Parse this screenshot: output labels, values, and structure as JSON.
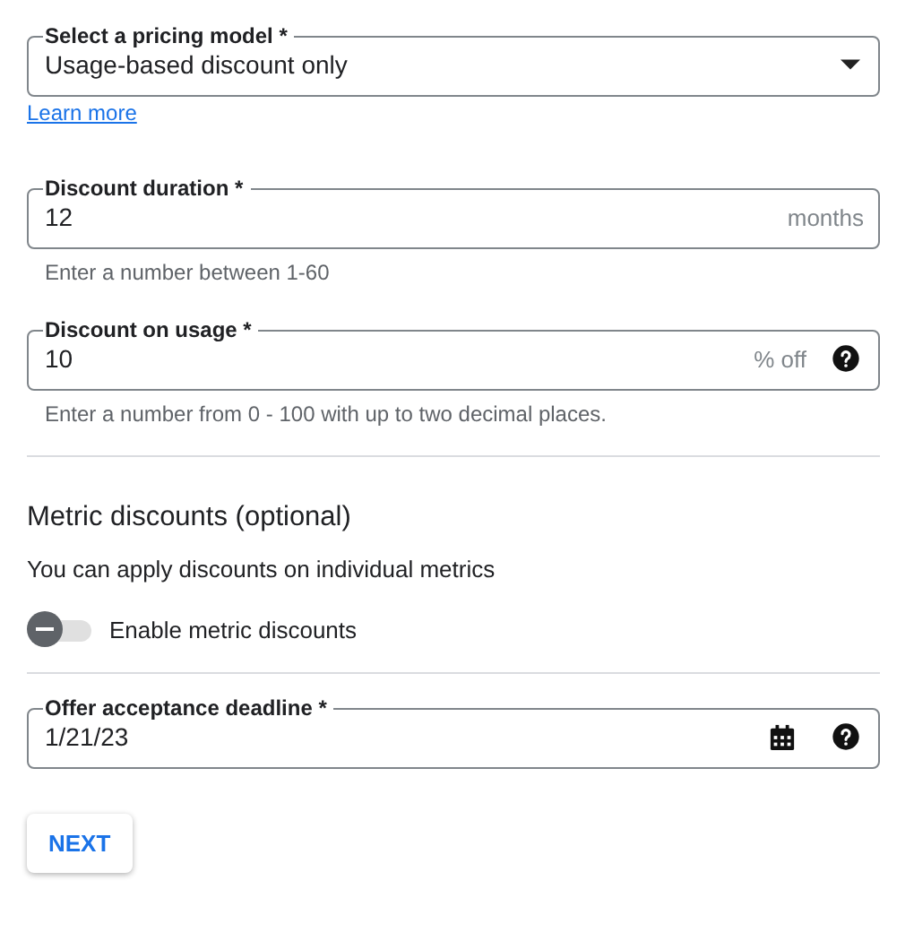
{
  "pricing_model": {
    "label": "Select a pricing model *",
    "value": "Usage-based discount only"
  },
  "learn_more": "Learn more",
  "discount_duration": {
    "label": "Discount duration *",
    "value": "12",
    "suffix": "months",
    "helper": "Enter a number between 1-60"
  },
  "discount_on_usage": {
    "label": "Discount on usage *",
    "value": "10",
    "suffix": "% off",
    "helper": "Enter a number from 0 - 100 with up to two decimal places."
  },
  "metric_discounts": {
    "heading": "Metric discounts (optional)",
    "description": "You can apply discounts on individual metrics",
    "toggle": {
      "label": "Enable metric discounts",
      "on": false
    }
  },
  "offer_deadline": {
    "label": "Offer acceptance deadline *",
    "value": "1/21/23"
  },
  "buttons": [
    "NEXT"
  ]
}
